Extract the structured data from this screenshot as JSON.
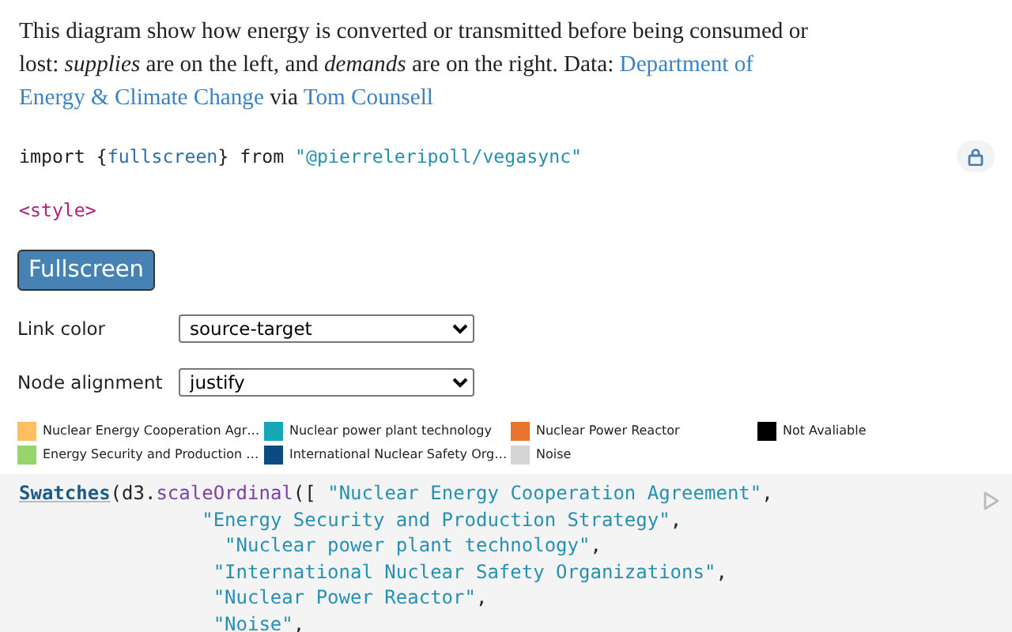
{
  "description": [
    {
      "kind": "text",
      "text": "This diagram show how energy is converted or transmitted before being consumed or lost: *supplies* are on the left, and *demands* are on the right. Data: "
    },
    {
      "kind": "link",
      "text": "Department of"
    },
    {
      "kind": "link",
      "text": "Energy & Climate Change"
    },
    {
      "kind": "text",
      "text": " via "
    },
    {
      "kind": "link",
      "text": "Tom Counsell"
    }
  ],
  "import_line": [
    {
      "kind": "keyword",
      "text": "import"
    },
    {
      "kind": "plain",
      "text": "{"
    },
    {
      "kind": "var",
      "text": "fullscreen"
    },
    {
      "kind": "plain",
      "text": "}"
    },
    {
      "kind": "keyword",
      "text": "from"
    },
    {
      "kind": "string",
      "text": "\"@pierreleripoll/vegasync\""
    }
  ],
  "style_tag": "<style>",
  "fullscreen_button": "Fullscreen",
  "controls": [
    {
      "label": "Link color",
      "value": "source-target"
    },
    {
      "label": "Node alignment",
      "value": "justify"
    }
  ],
  "legend": [
    {
      "label": "Nuclear Energy Cooperation Agr…",
      "color": "#fdbf5f"
    },
    {
      "label": "Energy Security and Production …",
      "color": "#98d46b"
    },
    {
      "label": "Nuclear power plant technology",
      "color": "#17a6b5"
    },
    {
      "label": "International Nuclear Safety Org…",
      "color": "#0c4a82"
    },
    {
      "label": "Nuclear Power Reactor",
      "color": "#e8732c"
    },
    {
      "label": "Noise",
      "color": "#d4d4d4"
    },
    {
      "label": "Not Avaliable",
      "color": "#000000"
    }
  ],
  "code": [
    {
      "kind": "first",
      "tokens": [
        {
          "kind": "func",
          "text": "Swatches"
        },
        {
          "kind": "plain",
          "text": "(d3."
        },
        {
          "kind": "method",
          "text": "scaleOrdinal"
        },
        {
          "kind": "plain",
          "text": "(["
        },
        {
          "kind": "string",
          "text": "\"Nuclear Energy Cooperation Agreement\""
        },
        {
          "kind": "plain",
          "text": ","
        }
      ]
    },
    {
      "kind": "item_narrow",
      "tokens": [
        {
          "kind": "string",
          "text": "\"Energy Security and Production Strategy\""
        },
        {
          "kind": "plain",
          "text": ","
        }
      ]
    },
    {
      "kind": "item_wide",
      "tokens": [
        {
          "kind": "string",
          "text": "\"Nuclear power plant technology\""
        },
        {
          "kind": "plain",
          "text": ","
        }
      ]
    },
    {
      "kind": "item",
      "tokens": [
        {
          "kind": "string",
          "text": "\"International Nuclear Safety Organizations\""
        },
        {
          "kind": "plain",
          "text": ","
        }
      ]
    },
    {
      "kind": "item",
      "tokens": [
        {
          "kind": "string",
          "text": "\"Nuclear Power Reactor\""
        },
        {
          "kind": "plain",
          "text": ","
        }
      ]
    },
    {
      "kind": "item",
      "tokens": [
        {
          "kind": "string",
          "text": "\"Noise\""
        },
        {
          "kind": "plain",
          "text": ","
        }
      ]
    }
  ]
}
